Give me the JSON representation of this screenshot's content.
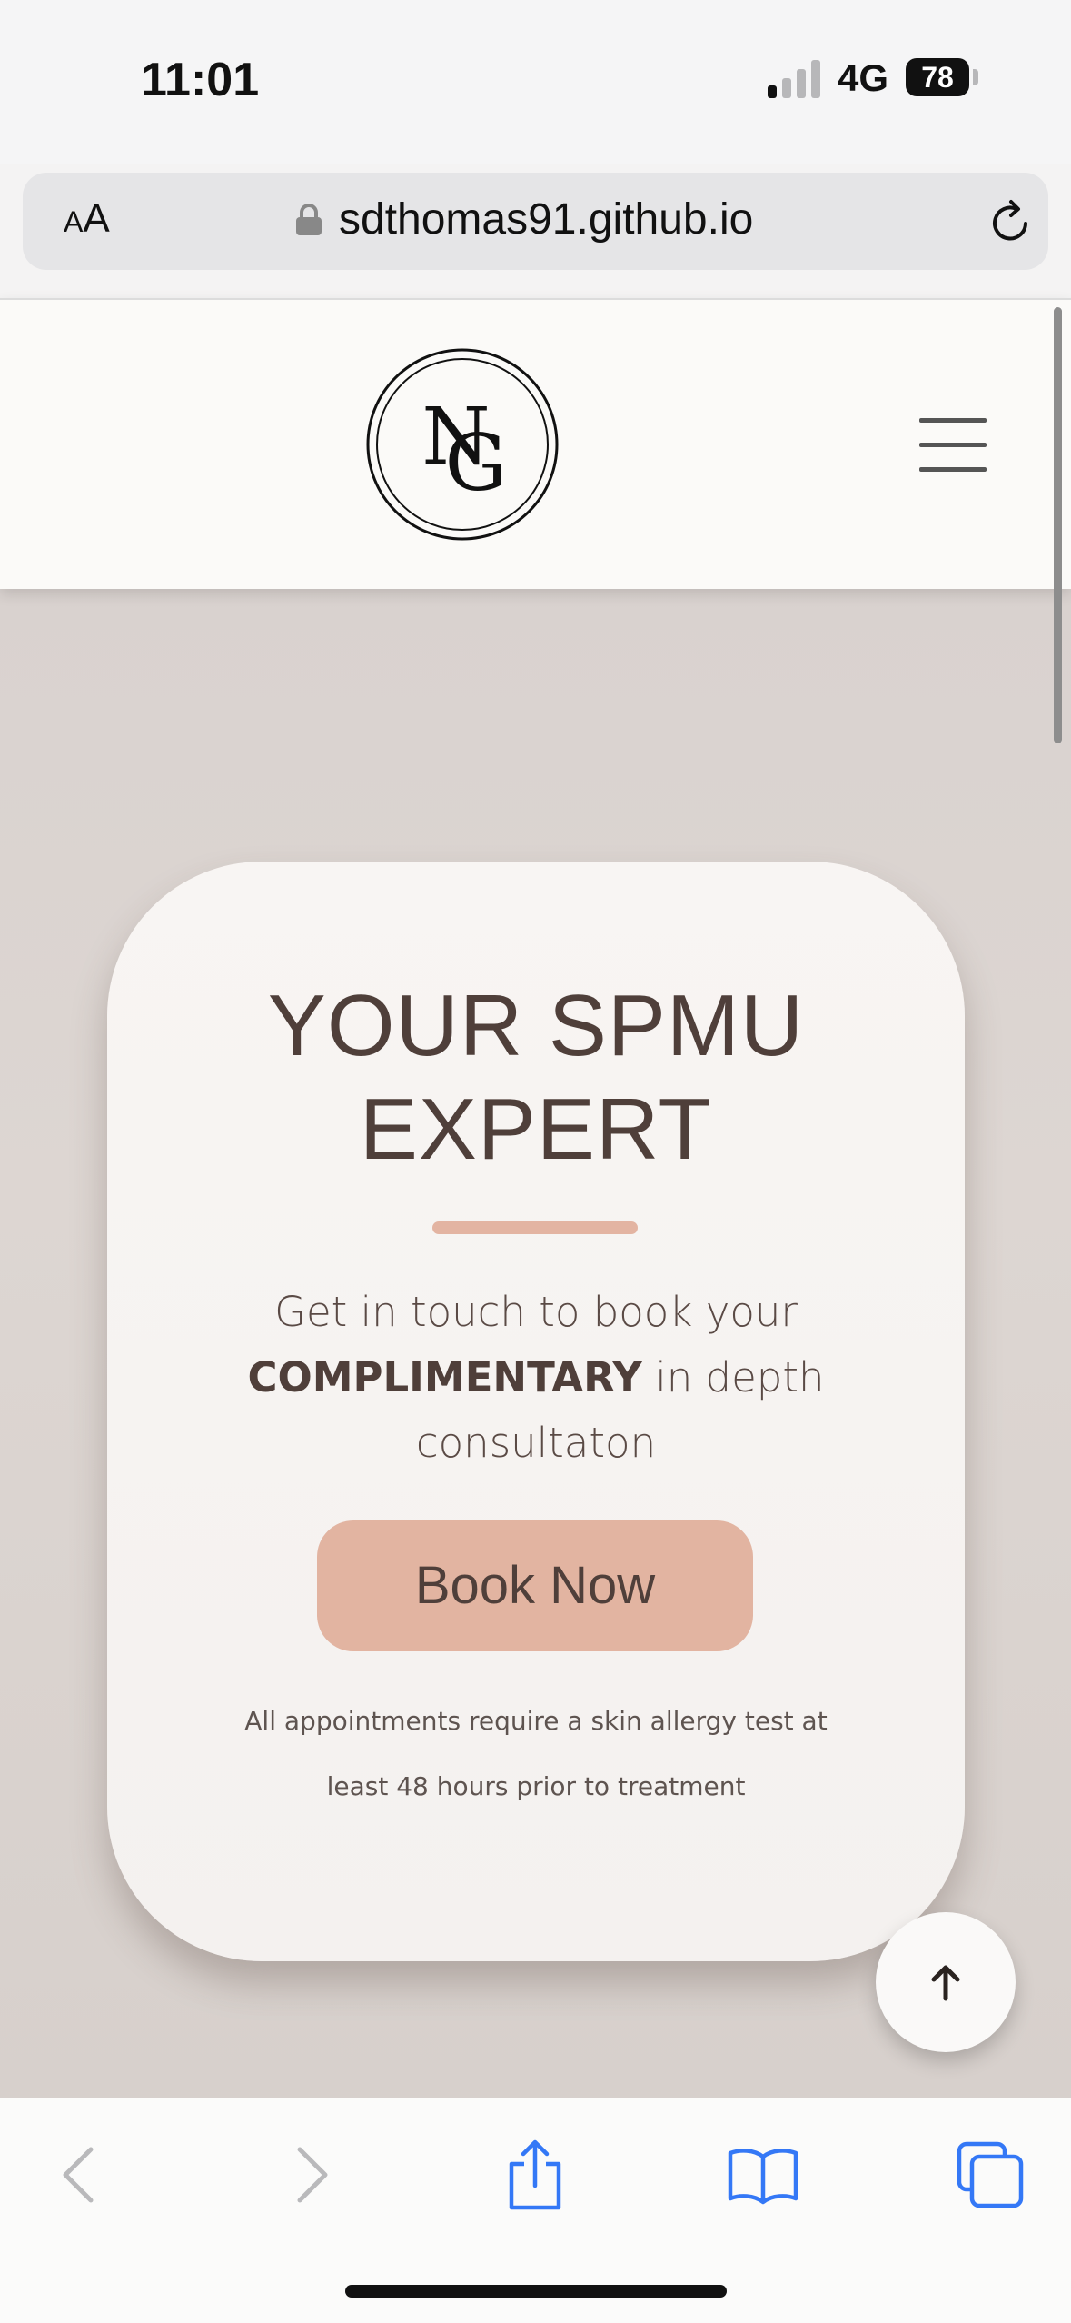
{
  "status_bar": {
    "time": "11:01",
    "network": "4G",
    "battery": "78"
  },
  "browser": {
    "aa_label": "AA",
    "url": "sdthomas91.github.io"
  },
  "site": {
    "logo_icon": "ng-monogram-logo",
    "menu_icon": "hamburger-menu-icon"
  },
  "hero": {
    "title_line1": "YOUR SPMU",
    "title_line2": "EXPERT",
    "text_part1": "Get in touch to book your",
    "text_strong": "COMPLIMENTARY",
    "text_part2": "in depth consultaton",
    "button_label": "Book Now",
    "note": "All appointments require a skin allergy test at least 48 hours prior to treatment"
  },
  "colors": {
    "accent": "#e2b4a1",
    "text": "#4f3f3a",
    "ios_blue": "#3478f6"
  },
  "toolbar_icons": [
    "back-icon",
    "forward-icon",
    "share-icon",
    "bookmarks-icon",
    "tabs-icon"
  ]
}
